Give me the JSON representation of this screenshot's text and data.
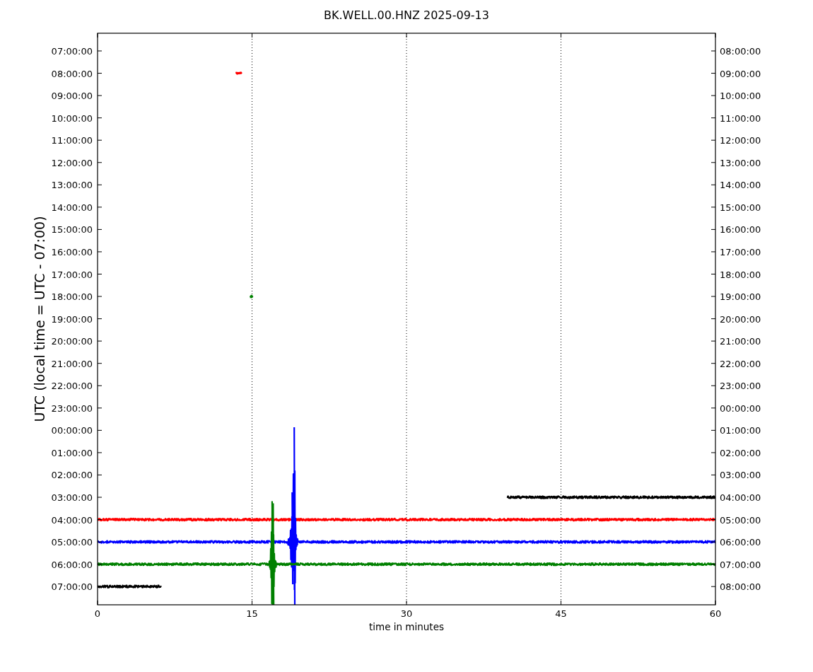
{
  "plot": {
    "title": "BK.WELL.00.HNZ 2025-09-13",
    "xlabel": "time in minutes",
    "ylabel": "UTC (local time = UTC - 07:00)",
    "x_tick_labels": [
      "0",
      "15",
      "30",
      "45",
      "60"
    ],
    "left_time_labels": [
      "07:00:00",
      "08:00:00",
      "09:00:00",
      "10:00:00",
      "11:00:00",
      "12:00:00",
      "13:00:00",
      "14:00:00",
      "15:00:00",
      "16:00:00",
      "17:00:00",
      "18:00:00",
      "19:00:00",
      "20:00:00",
      "21:00:00",
      "22:00:00",
      "23:00:00",
      "00:00:00",
      "01:00:00",
      "02:00:00",
      "03:00:00",
      "04:00:00",
      "05:00:00",
      "06:00:00",
      "07:00:00"
    ],
    "right_time_labels": [
      "08:00:00",
      "09:00:00",
      "10:00:00",
      "11:00:00",
      "12:00:00",
      "13:00:00",
      "14:00:00",
      "15:00:00",
      "16:00:00",
      "17:00:00",
      "18:00:00",
      "19:00:00",
      "20:00:00",
      "21:00:00",
      "22:00:00",
      "23:00:00",
      "00:00:00",
      "01:00:00",
      "02:00:00",
      "03:00:00",
      "04:00:00",
      "05:00:00",
      "06:00:00",
      "07:00:00",
      "08:00:00"
    ],
    "traces": [
      {
        "color": "#ff0000"
      },
      {
        "color": "#008000"
      },
      {
        "color": "#000000"
      },
      {
        "color": "#ff0000"
      },
      {
        "color": "#0000ff"
      },
      {
        "color": "#008000"
      },
      {
        "color": "#000000"
      }
    ]
  }
}
